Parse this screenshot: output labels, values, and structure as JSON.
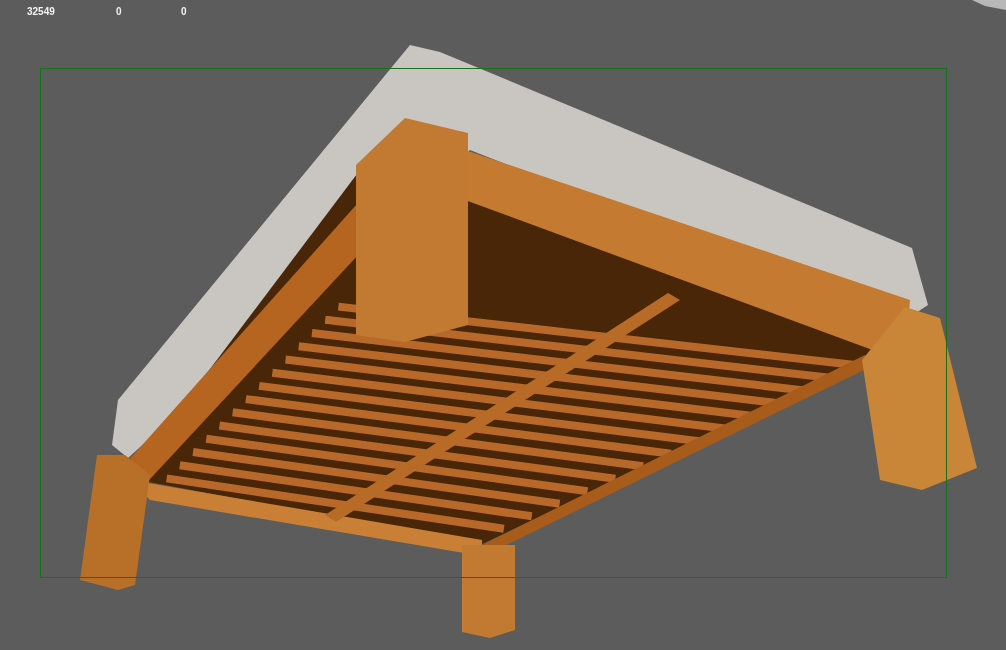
{
  "viewport": {
    "stats": [
      "32549",
      "0",
      "0"
    ]
  }
}
